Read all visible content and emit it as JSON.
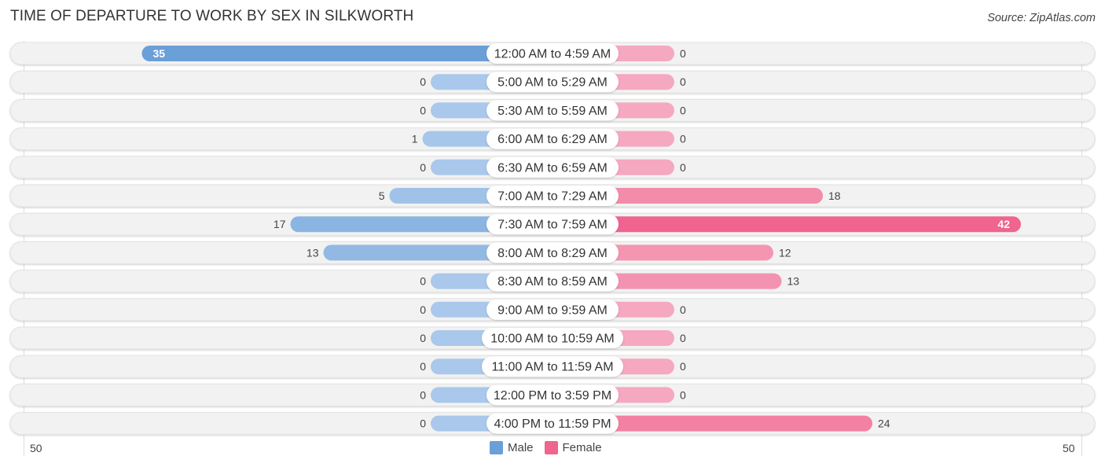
{
  "title": "TIME OF DEPARTURE TO WORK BY SEX IN SILKWORTH",
  "source": "Source: ZipAtlas.com",
  "colors": {
    "male": "#6a9fd8",
    "male_light": "#a9c8eb",
    "female": "#f0648f",
    "female_light": "#f5a8c0",
    "row_bg": "#f2f2f2"
  },
  "chart_data": {
    "type": "bar",
    "orientation": "horizontal-diverging",
    "title": "TIME OF DEPARTURE TO WORK BY SEX IN SILKWORTH",
    "categories": [
      "12:00 AM to 4:59 AM",
      "5:00 AM to 5:29 AM",
      "5:30 AM to 5:59 AM",
      "6:00 AM to 6:29 AM",
      "6:30 AM to 6:59 AM",
      "7:00 AM to 7:29 AM",
      "7:30 AM to 7:59 AM",
      "8:00 AM to 8:29 AM",
      "8:30 AM to 8:59 AM",
      "9:00 AM to 9:59 AM",
      "10:00 AM to 10:59 AM",
      "11:00 AM to 11:59 AM",
      "12:00 PM to 3:59 PM",
      "4:00 PM to 11:59 PM"
    ],
    "series": [
      {
        "name": "Male",
        "values": [
          35,
          0,
          0,
          1,
          0,
          5,
          17,
          13,
          0,
          0,
          0,
          0,
          0,
          0
        ]
      },
      {
        "name": "Female",
        "values": [
          0,
          0,
          0,
          0,
          0,
          18,
          42,
          12,
          13,
          0,
          0,
          0,
          0,
          24
        ]
      }
    ],
    "axis": {
      "left_label": "50",
      "right_label": "50",
      "range": [
        -50,
        50
      ]
    },
    "legend": {
      "position": "bottom-center",
      "entries": [
        "Male",
        "Female"
      ]
    },
    "grid": false
  }
}
